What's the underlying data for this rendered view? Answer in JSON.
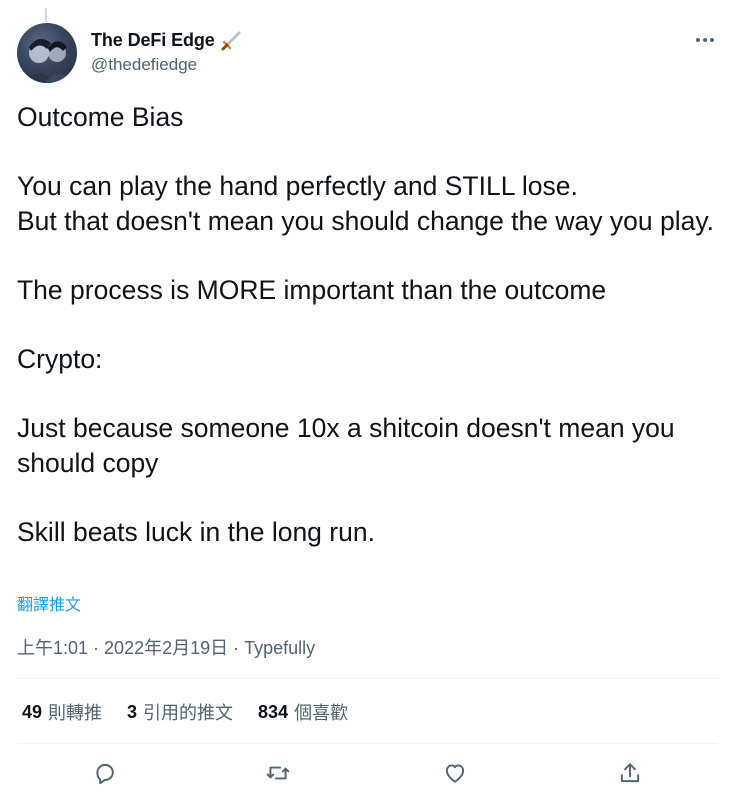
{
  "author": {
    "display_name": "The DeFi Edge",
    "handle": "@thedefiedge",
    "name_emoji": "dagger-icon"
  },
  "tweet": {
    "paragraphs": [
      "Outcome Bias",
      "You can play the hand perfectly and STILL lose.\nBut that doesn't mean you should change the way you play.",
      "The process is MORE important than the outcome",
      "Crypto:",
      "Just because someone 10x a shitcoin doesn't mean you should copy",
      "Skill beats luck in the long run."
    ],
    "translate_label": "翻譯推文",
    "time": "上午1:01",
    "date": "2022年2月19日",
    "source": "Typefully",
    "separator": " · "
  },
  "stats": {
    "retweets": {
      "count": "49",
      "label": "則轉推"
    },
    "quotes": {
      "count": "3",
      "label": "引用的推文"
    },
    "likes": {
      "count": "834",
      "label": "個喜歡"
    }
  },
  "colors": {
    "text": "#0f1419",
    "secondary": "#536471",
    "link": "#1d9bf0",
    "divider": "#eff3f4"
  }
}
